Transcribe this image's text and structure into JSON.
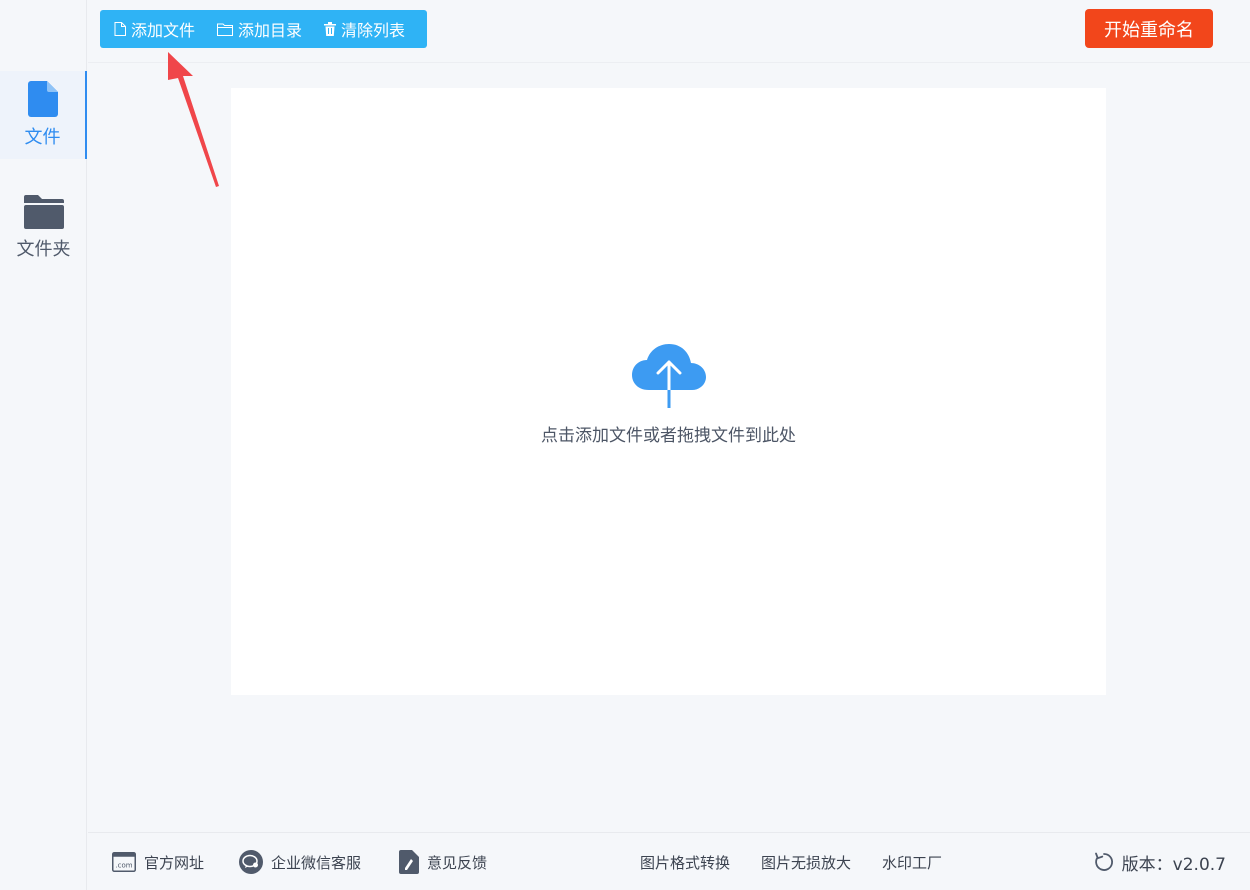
{
  "sidebar": {
    "items": [
      {
        "label": "文件",
        "icon": "file-icon",
        "active": true
      },
      {
        "label": "文件夹",
        "icon": "folder-icon",
        "active": false
      }
    ]
  },
  "toolbar": {
    "add_file": "添加文件",
    "add_dir": "添加目录",
    "clear_list": "清除列表"
  },
  "start_button": "开始重命名",
  "dropzone": {
    "hint": "点击添加文件或者拖拽文件到此处"
  },
  "footer": {
    "official_site": "官方网址",
    "wechat_service": "企业微信客服",
    "feedback": "意见反馈",
    "format_convert": "图片格式转换",
    "lossless_upscale": "图片无损放大",
    "watermark_factory": "水印工厂",
    "version": "版本：v2.0.7"
  },
  "colors": {
    "toolbar_bg": "#2fb3f5",
    "start_button_bg": "#f2461b",
    "accent_blue": "#2f8cf0",
    "annotation_red": "#f0464a"
  }
}
